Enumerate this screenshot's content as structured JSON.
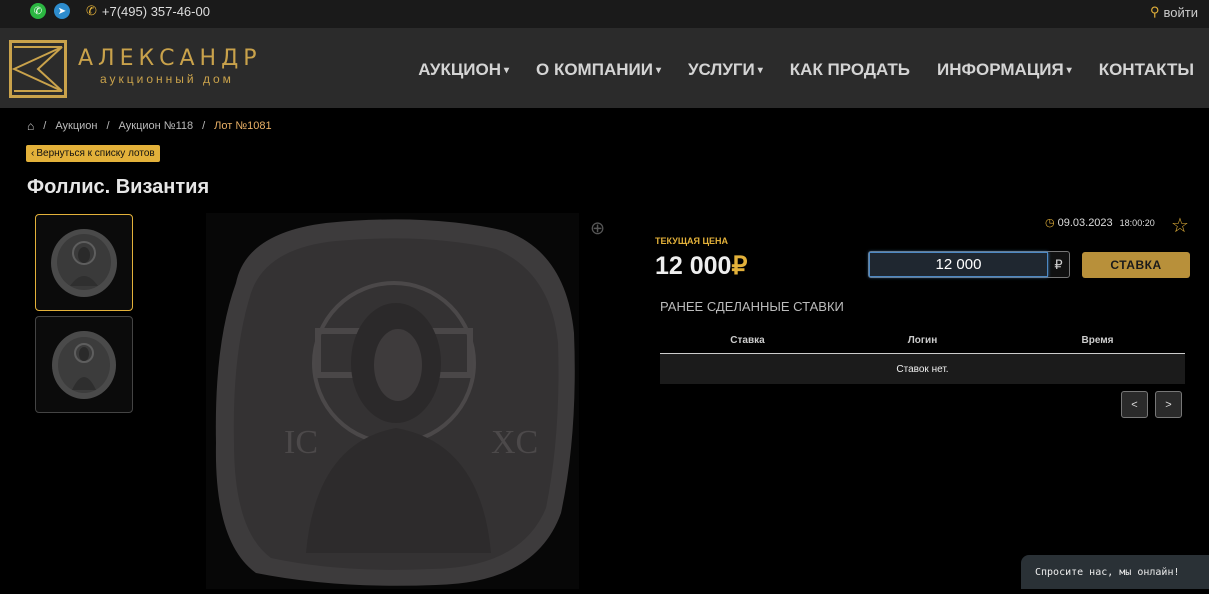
{
  "topbar": {
    "phone": "+7(495) 357-46-00",
    "login": "войти",
    "icons": [
      "whatsapp-icon",
      "telegram-icon",
      "phone-icon",
      "user-icon"
    ]
  },
  "brand": {
    "name": "АЛЕКСАНДР",
    "subtitle": "аукционный дом"
  },
  "nav": {
    "items": [
      {
        "label": "АУКЦИОН",
        "dropdown": true
      },
      {
        "label": "О КОМПАНИИ",
        "dropdown": true
      },
      {
        "label": "УСЛУГИ",
        "dropdown": true
      },
      {
        "label": "КАК ПРОДАТЬ",
        "dropdown": false
      },
      {
        "label": "ИНФОРМАЦИЯ",
        "dropdown": true
      },
      {
        "label": "КОНТАКТЫ",
        "dropdown": false
      }
    ]
  },
  "breadcrumb": [
    "Аукцион",
    "Аукцион №118",
    "Лот №1081"
  ],
  "back_button": "Вернуться к списку лотов",
  "lot": {
    "title": "Фоллис. Византия",
    "date": "09.03.2023",
    "time": "18:00:20"
  },
  "price": {
    "label": "ТЕКУЩАЯ ЦЕНА",
    "value": "12 000",
    "currency": "₽"
  },
  "bid": {
    "value": "12 000",
    "currency": "₽",
    "button": "СТАВКА"
  },
  "bids": {
    "title": "РАНЕЕ СДЕЛАННЫЕ СТАВКИ",
    "columns": [
      "Ставка",
      "Логин",
      "Время"
    ],
    "empty": "Ставок нет.",
    "prev": "<",
    "next": ">"
  },
  "chat": "Спросите нас, мы онлайн!",
  "colors": {
    "accent": "#e3b13a",
    "nav_bg": "#2b2b2b",
    "bg": "#000000"
  }
}
